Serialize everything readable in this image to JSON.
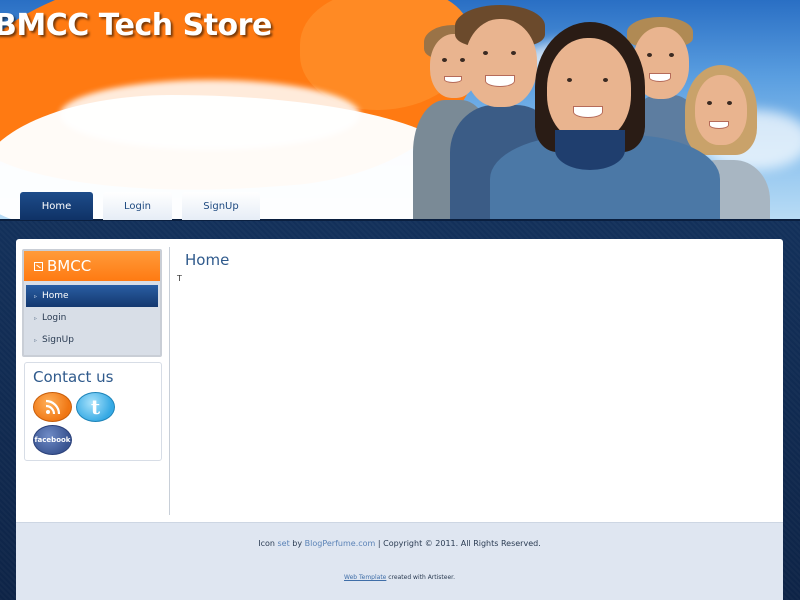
{
  "header": {
    "site_title": "BMCC Tech Store"
  },
  "nav": {
    "tabs": [
      {
        "label": "Home",
        "active": true
      },
      {
        "label": "Login",
        "active": false
      },
      {
        "label": "SignUp",
        "active": false
      }
    ]
  },
  "sidebar": {
    "menu_title": "BMCC",
    "menu_items": [
      {
        "label": "Home",
        "active": true
      },
      {
        "label": "Login",
        "active": false
      },
      {
        "label": "SignUp",
        "active": false
      }
    ],
    "contact": {
      "title": "Contact us",
      "icons": [
        "rss-icon",
        "twitter-icon",
        "facebook-icon"
      ],
      "twitter_glyph": "t",
      "facebook_text": "facebook"
    }
  },
  "main": {
    "title": "Home",
    "text": "T"
  },
  "footer": {
    "icon_prefix": "Icon",
    "icon_set_link": "set",
    "icon_by": "by",
    "icon_site_link": "BlogPerfume.com",
    "copyright": "| Copyright © 2011. All Rights Reserved.",
    "template_link": "Web Template",
    "template_suffix": "created with Artisteer."
  },
  "colors": {
    "accent_orange": "#ff7a12",
    "nav_active": "#14386f",
    "link": "#5b83b7",
    "heading": "#2f5a8c"
  }
}
